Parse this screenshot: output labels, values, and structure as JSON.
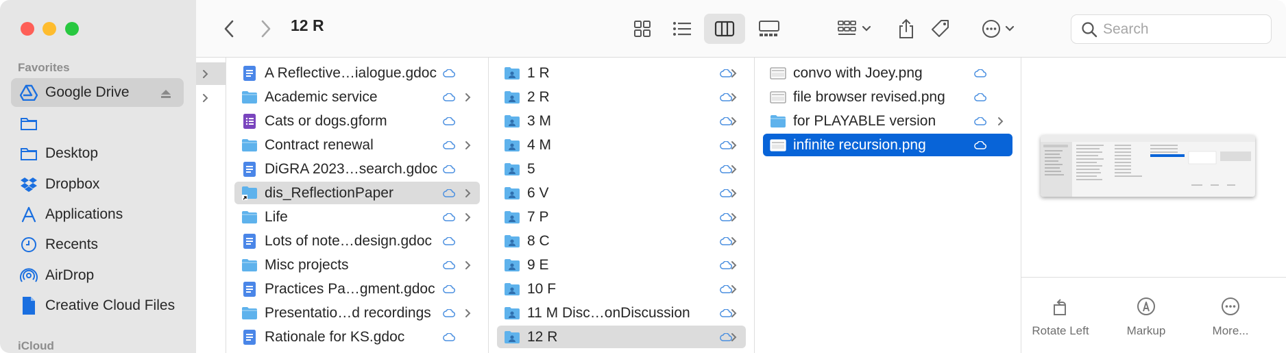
{
  "toolbar": {
    "title": "12   R",
    "search_placeholder": "Search"
  },
  "sidebar": {
    "favorites_label": "Favorites",
    "icloud_label": "iCloud",
    "items": [
      {
        "label": "Google Drive",
        "icon": "google-drive-icon"
      },
      {
        "label": "",
        "icon": "folder-icon"
      },
      {
        "label": "Desktop",
        "icon": "desktop-folder-icon"
      },
      {
        "label": "Dropbox",
        "icon": "dropbox-icon"
      },
      {
        "label": "Applications",
        "icon": "applications-icon"
      },
      {
        "label": "Recents",
        "icon": "clock-icon"
      },
      {
        "label": "AirDrop",
        "icon": "airdrop-icon"
      },
      {
        "label": "Creative Cloud Files",
        "icon": "document-icon"
      }
    ]
  },
  "column1": {
    "items": [
      {
        "label": "A Reflective…ialogue.gdoc",
        "type": "gdoc"
      },
      {
        "label": "Academic service",
        "type": "folder"
      },
      {
        "label": "Cats or dogs.gform",
        "type": "gform"
      },
      {
        "label": "Contract renewal",
        "type": "folder"
      },
      {
        "label": "DiGRA 2023…search.gdoc",
        "type": "gdoc"
      },
      {
        "label": "dis_ReflectionPaper",
        "type": "folder-alias"
      },
      {
        "label": "Life",
        "type": "folder"
      },
      {
        "label": "Lots of note…design.gdoc",
        "type": "gdoc"
      },
      {
        "label": "Misc projects",
        "type": "folder"
      },
      {
        "label": "Practices Pa…gment.gdoc",
        "type": "gdoc"
      },
      {
        "label": "Presentatio…d recordings",
        "type": "folder"
      },
      {
        "label": "Rationale for KS.gdoc",
        "type": "gdoc"
      }
    ]
  },
  "column2": {
    "items": [
      {
        "label": "1   R"
      },
      {
        "label": "2   R"
      },
      {
        "label": "3   M"
      },
      {
        "label": "4   M"
      },
      {
        "label": "5"
      },
      {
        "label": "6   V"
      },
      {
        "label": "7   P"
      },
      {
        "label": "8   C"
      },
      {
        "label": "9   E"
      },
      {
        "label": "10   F"
      },
      {
        "label": "11   M   Disc…onDiscussion"
      },
      {
        "label": "12   R"
      }
    ]
  },
  "column3": {
    "items": [
      {
        "label": "convo with Joey.png",
        "type": "png"
      },
      {
        "label": "file browser revised.png",
        "type": "png"
      },
      {
        "label": "for PLAYABLE version",
        "type": "folder"
      },
      {
        "label": "infinite recursion.png",
        "type": "png"
      }
    ]
  },
  "preview": {
    "actions": [
      {
        "label": "Rotate Left",
        "icon": "rotate-left-icon"
      },
      {
        "label": "Markup",
        "icon": "markup-icon"
      },
      {
        "label": "More...",
        "icon": "more-icon"
      }
    ]
  },
  "colors": {
    "accent": "#0864d8",
    "folder": "#5eb2ec",
    "gdoc": "#4a86e8",
    "gform": "#7a45be",
    "sidebar_icon": "#1a6fe0"
  }
}
